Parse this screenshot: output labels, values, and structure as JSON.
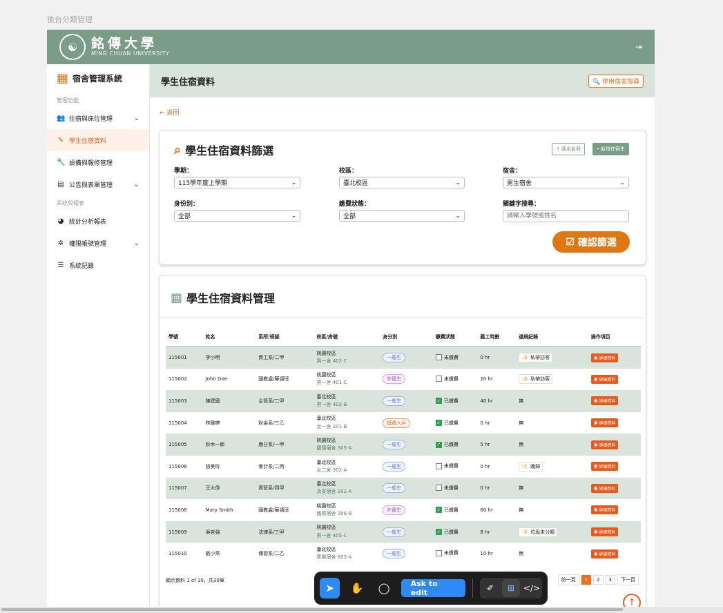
{
  "page_caption": "後台分類管理",
  "brand": {
    "name_cn": "銘傳大學",
    "name_en": "MING CHUAN UNIVERSITY"
  },
  "icons": {
    "logout": "logout-icon"
  },
  "sidebar": {
    "system_title": "宿舍管理系統",
    "section_manage": "管理功能",
    "section_system": "系統與報表",
    "items": [
      {
        "label": "住宿與床位管理",
        "icon": "users-icon",
        "chevron": true
      },
      {
        "label": "學生住宿資料",
        "icon": "user-edit-icon",
        "active": true
      },
      {
        "label": "設備與報修管理",
        "icon": "wrench-icon"
      },
      {
        "label": "公告與表單管理",
        "icon": "document-icon",
        "chevron": true
      },
      {
        "label": "統計分析報表",
        "icon": "pie-chart-icon"
      },
      {
        "label": "權限帳號管理",
        "icon": "gear-icon",
        "chevron": true
      },
      {
        "label": "系統記錄",
        "icon": "list-icon"
      }
    ]
  },
  "header": {
    "title": "學生住宿資料",
    "disable_button": "停用宿舍搜尋"
  },
  "back_label": "← 返回",
  "filter": {
    "title": "學生住宿資料篩選",
    "export_button": "匯出名冊",
    "add_button": "新增住宿生",
    "semester_label": "學期：",
    "semester_value": "115學年度上學期",
    "campus_label": "校區：",
    "campus_value": "臺北校區",
    "dorm_label": "宿舍：",
    "dorm_value": "男生宿舍",
    "identity_label": "身份別：",
    "identity_value": "全部",
    "payment_label": "繳費狀態：",
    "payment_value": "全部",
    "keyword_label": "關鍵字搜尋：",
    "keyword_placeholder": "請輸入學號或姓名",
    "confirm_button": "確認篩選"
  },
  "table": {
    "title": "學生住宿資料管理",
    "columns": [
      "學號",
      "姓名",
      "系所/班級",
      "校區/房號",
      "身分別",
      "繳費狀態",
      "義工時數",
      "違規紀錄",
      "操作項目"
    ],
    "detail_label": "詳細資料",
    "rows": [
      {
        "id": "115001",
        "name": "李小明",
        "dept": "資工系/二甲",
        "campus": "桃園校區",
        "room": "男一舍 402-C",
        "identity": "一般生",
        "identity_type": "general",
        "paid": false,
        "paid_label": "未繳費",
        "hours": "0 hr",
        "violation_num": "-3",
        "violation": "私帶訪客"
      },
      {
        "id": "115002",
        "name": "John Doe",
        "dept": "國教處/華語班",
        "campus": "桃園校區",
        "room": "男一舍 401-C",
        "identity": "外籍生",
        "identity_type": "foreign",
        "paid": false,
        "paid_label": "未繳費",
        "hours": "20 hr",
        "violation_num": "-3",
        "violation": "私帶訪客"
      },
      {
        "id": "115003",
        "name": "陳建國",
        "dept": "企管系/二甲",
        "campus": "臺北校區",
        "room": "男一舍 402-B",
        "identity": "一般生",
        "identity_type": "general",
        "paid": true,
        "paid_label": "已繳費",
        "hours": "40 hr",
        "violation_num": "",
        "violation": "無"
      },
      {
        "id": "115004",
        "name": "林雅婷",
        "dept": "財金系/三乙",
        "campus": "臺北校區",
        "room": "女一舍 201-B",
        "identity": "低收入戶",
        "identity_type": "low",
        "paid": true,
        "paid_label": "已繳費",
        "hours": "0 hr",
        "violation_num": "",
        "violation": "無"
      },
      {
        "id": "115005",
        "name": "鈴木一郎",
        "dept": "應日系/一甲",
        "campus": "桃園校區",
        "room": "國際宿舍 305-A",
        "identity": "一般生",
        "identity_type": "general",
        "paid": true,
        "paid_label": "已繳費",
        "hours": "5 hr",
        "violation_num": "",
        "violation": "無"
      },
      {
        "id": "115006",
        "name": "張美玲",
        "dept": "會計系/二丙",
        "campus": "臺北校區",
        "room": "女二舍 302-A",
        "identity": "一般生",
        "identity_type": "general",
        "paid": false,
        "paid_label": "未繳費",
        "hours": "0 hr",
        "violation_num": "-1",
        "violation": "晚歸"
      },
      {
        "id": "115007",
        "name": "王大偉",
        "dept": "資管系/四甲",
        "campus": "臺北校區",
        "room": "永安宿舍 101-A",
        "identity": "一般生",
        "identity_type": "general",
        "paid": false,
        "paid_label": "未繳費",
        "hours": "0 hr",
        "violation_num": "",
        "violation": "無"
      },
      {
        "id": "115008",
        "name": "Mary Smith",
        "dept": "國教處/華語班",
        "campus": "桃園校區",
        "room": "國際宿舍 306-B",
        "identity": "外籍生",
        "identity_type": "foreign",
        "paid": true,
        "paid_label": "已繳費",
        "hours": "60 hr",
        "violation_num": "",
        "violation": "無"
      },
      {
        "id": "115009",
        "name": "吳克強",
        "dept": "法律系/三甲",
        "campus": "桃園校區",
        "room": "男一舍 405-C",
        "identity": "一般生",
        "identity_type": "general",
        "paid": true,
        "paid_label": "已繳費",
        "hours": "8 hr",
        "violation_num": "-2",
        "violation": "垃圾未分類"
      },
      {
        "id": "115010",
        "name": "劉小燕",
        "dept": "傳管系/二乙",
        "campus": "臺北校區",
        "room": "集賢宿舍 603-A",
        "identity": "一般生",
        "identity_type": "general",
        "paid": false,
        "paid_label": "未繳費",
        "hours": "10 hr",
        "violation_num": "",
        "violation": "無"
      }
    ]
  },
  "pagination": {
    "info": "顯示資料 1 of 10，共30筆",
    "prev": "前一頁",
    "pages": [
      "1",
      "2",
      "3"
    ],
    "current": "1",
    "next": "下一頁"
  },
  "toolbar": {
    "ask_label": "Ask to edit"
  }
}
